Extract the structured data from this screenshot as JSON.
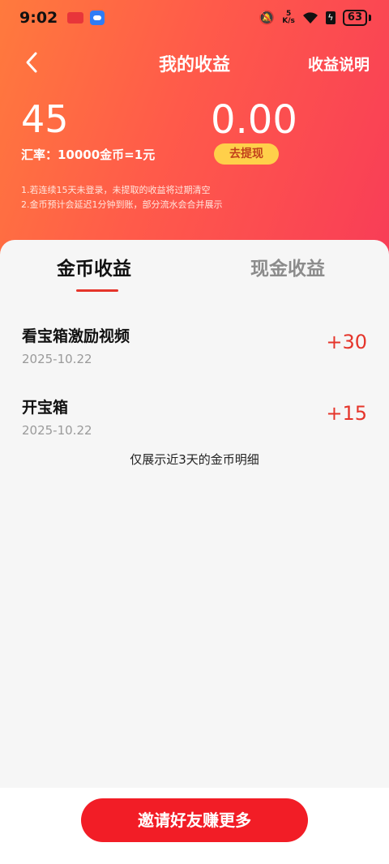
{
  "status_bar": {
    "time": "9:02",
    "net_speed_value": "5",
    "net_speed_unit": "K/s",
    "battery": "63"
  },
  "nav": {
    "title": "我的收益",
    "action": "收益说明"
  },
  "summary": {
    "coins": "45",
    "rate": "汇率：10000金币=1元",
    "cash": "0.00",
    "withdraw_label": "去提现",
    "notes": [
      "1.若连续15天未登录，未提取的收益将过期清空",
      "2.金币预计会延迟1分钟到账，部分流水会合并展示"
    ]
  },
  "tabs": [
    {
      "label": "金币收益",
      "active": true
    },
    {
      "label": "现金收益",
      "active": false
    }
  ],
  "records": [
    {
      "title": "看宝箱激励视频",
      "date": "2025-10.22",
      "value": "+30"
    },
    {
      "title": "开宝箱",
      "date": "2025-10.22",
      "value": "+15"
    }
  ],
  "hint": "仅展示近3天的金币明细",
  "invite_label": "邀请好友赚更多",
  "colors": {
    "accent": "#e5352b",
    "button": "#f21d26",
    "withdraw_bg": "#ffd04a"
  }
}
